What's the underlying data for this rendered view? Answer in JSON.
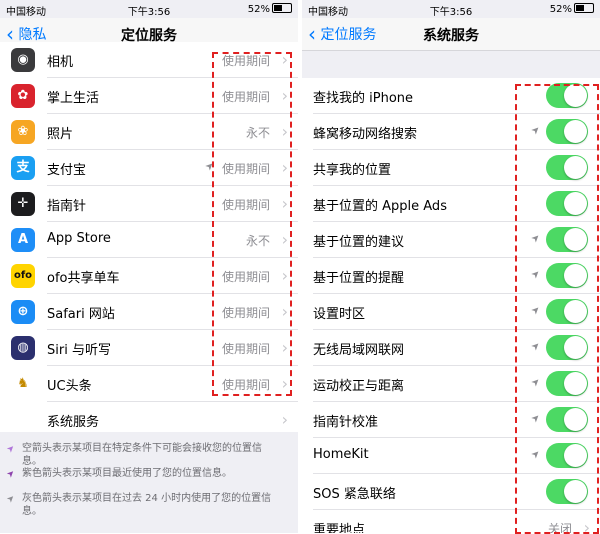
{
  "colors": {
    "ios_blue": "#007aff",
    "toggle_on": "#4cd964",
    "highlight": "#e02020"
  },
  "left": {
    "status": {
      "carrier": "中国移动",
      "time": "下午3:56",
      "battery": "52%"
    },
    "nav": {
      "back": "隐私",
      "title": "定位服务"
    },
    "rows": [
      {
        "label": "相机",
        "value": "使用期间",
        "icon": "camera-icon",
        "icon_color": "#3a3a3c",
        "glyph": "◉",
        "arrow": false
      },
      {
        "label": "掌上生活",
        "value": "使用期间",
        "icon": "palm-life-icon",
        "icon_color": "#d9232d",
        "glyph": "✿",
        "arrow": false
      },
      {
        "label": "照片",
        "value": "永不",
        "icon": "photos-icon",
        "icon_color": "#f6a623",
        "glyph": "❀",
        "arrow": false
      },
      {
        "label": "支付宝",
        "value": "使用期间",
        "icon": "alipay-icon",
        "icon_color": "#1a9ff2",
        "glyph": "支",
        "arrow": true
      },
      {
        "label": "指南针",
        "value": "使用期间",
        "icon": "compass-icon",
        "icon_color": "#1c1c1e",
        "glyph": "✛",
        "arrow": false
      },
      {
        "label": "App Store",
        "value": "永不",
        "icon": "app-store-icon",
        "icon_color": "#1e8ef7",
        "glyph": "A",
        "arrow": false
      },
      {
        "label": "ofo共享单车",
        "value": "使用期间",
        "icon": "ofo-icon",
        "icon_color": "#ffd400",
        "glyph": "ofo",
        "arrow": false
      },
      {
        "label": "Safari 网站",
        "value": "使用期间",
        "icon": "safari-icon",
        "icon_color": "#1b8cf5",
        "glyph": "⊕",
        "arrow": false
      },
      {
        "label": "Siri 与听写",
        "value": "使用期间",
        "icon": "siri-icon",
        "icon_color": "#2b2f6e",
        "glyph": "◍",
        "arrow": false
      },
      {
        "label": "UC头条",
        "value": "使用期间",
        "icon": "uc-headline-icon",
        "icon_color": "#ffffff",
        "glyph": "♞",
        "arrow": false
      }
    ],
    "system_services": "系统服务",
    "footer": [
      {
        "text": "空箭头表示某项目在特定条件下可能会接收您的位置信息。",
        "color": "#b076d9"
      },
      {
        "text": "紫色箭头表示某项目最近使用了您的位置信息。",
        "color": "#8e44ad"
      },
      {
        "text": "灰色箭头表示某项目在过去 24 小时内使用了您的位置信息。",
        "color": "#8e8e93"
      }
    ]
  },
  "right": {
    "status": {
      "carrier": "中国移动",
      "time": "下午3:56",
      "battery": "52%"
    },
    "nav": {
      "back": "定位服务",
      "title": "系统服务"
    },
    "rows": [
      {
        "label": "查找我的 iPhone",
        "on": true,
        "arrow": false
      },
      {
        "label": "蜂窝移动网络搜索",
        "on": true,
        "arrow": true
      },
      {
        "label": "共享我的位置",
        "on": true,
        "arrow": false
      },
      {
        "label": "基于位置的 Apple Ads",
        "on": true,
        "arrow": false
      },
      {
        "label": "基于位置的建议",
        "on": true,
        "arrow": true
      },
      {
        "label": "基于位置的提醒",
        "on": true,
        "arrow": true
      },
      {
        "label": "设置时区",
        "on": true,
        "arrow": true
      },
      {
        "label": "无线局域网联网",
        "on": true,
        "arrow": true
      },
      {
        "label": "运动校正与距离",
        "on": true,
        "arrow": true
      },
      {
        "label": "指南针校准",
        "on": true,
        "arrow": true
      },
      {
        "label": "HomeKit",
        "on": true,
        "arrow": true
      },
      {
        "label": "SOS 紧急联络",
        "on": true,
        "arrow": false
      }
    ],
    "last_row": {
      "label": "重要地点",
      "value": "关闭"
    }
  }
}
